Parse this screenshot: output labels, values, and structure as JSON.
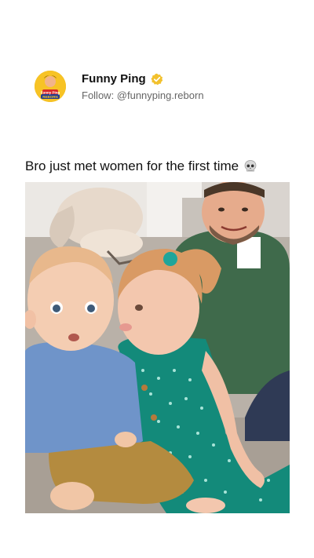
{
  "post": {
    "account_name": "Funny Ping",
    "follow_text": "Follow: @funnyping.reborn",
    "caption": "Bro just met women for the first time",
    "caption_emoji": "skull-icon",
    "verified_badge": "verified-badge-icon",
    "logo_text": "Funny Ping REBORN"
  },
  "colors": {
    "accent": "#f7c325",
    "text_primary": "#111111",
    "text_secondary": "#666666"
  }
}
